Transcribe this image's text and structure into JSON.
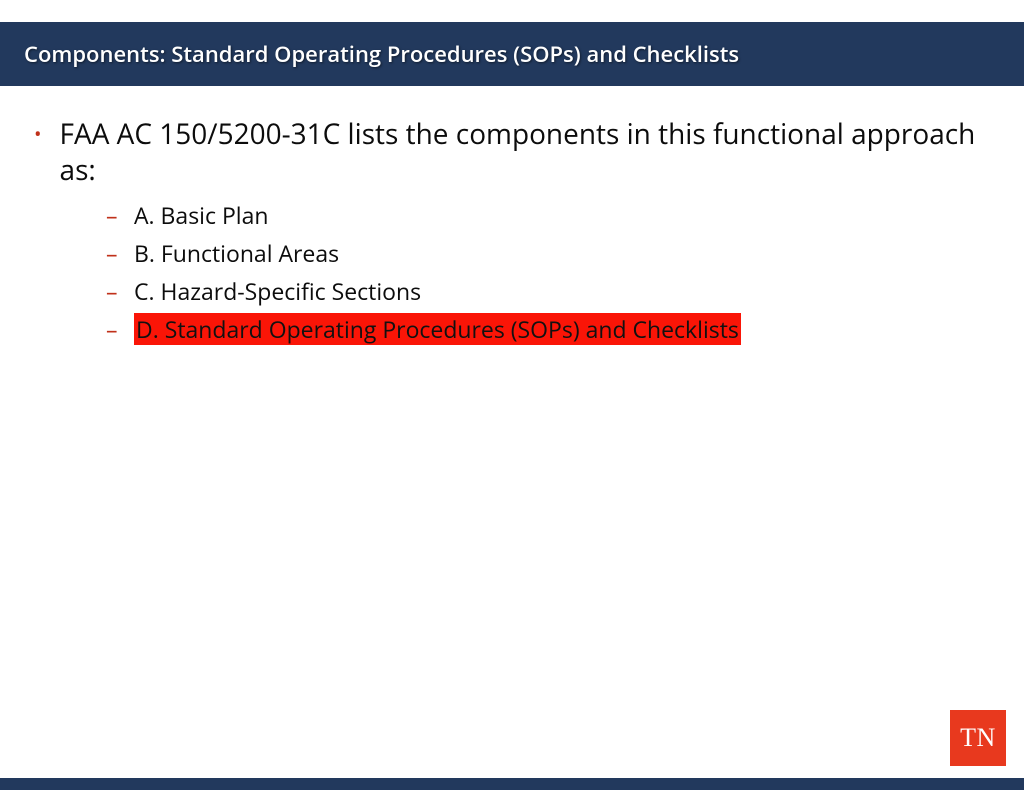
{
  "header": {
    "title": "Components: Standard Operating Procedures (SOPs) and Checklists"
  },
  "content": {
    "main_bullet": "FAA AC 150/5200-31C lists the components in this functional approach as:",
    "sub_items": [
      {
        "text": "A. Basic Plan",
        "highlighted": false
      },
      {
        "text": "B. Functional Areas",
        "highlighted": false
      },
      {
        "text": "C. Hazard-Specific Sections",
        "highlighted": false
      },
      {
        "text": "D. Standard Operating Procedures (SOPs) and Checklists",
        "highlighted": true
      }
    ]
  },
  "footer": {
    "logo_text": "TN"
  },
  "colors": {
    "header_bg": "#22395d",
    "bullet_accent": "#c0311a",
    "highlight_bg": "#fa1507",
    "logo_bg": "#e8391e"
  }
}
